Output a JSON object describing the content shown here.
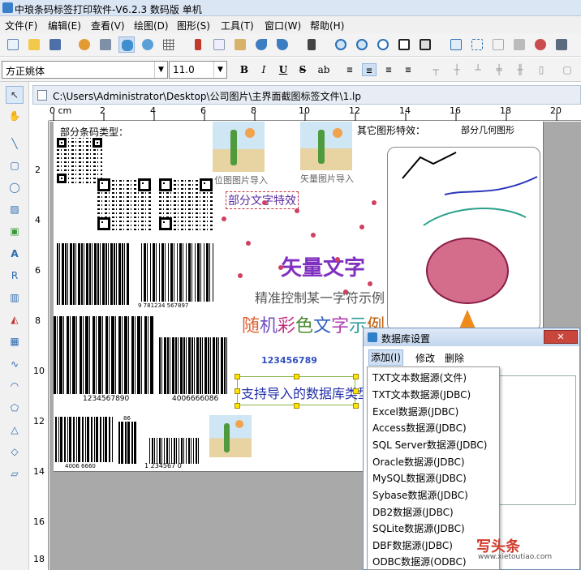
{
  "window": {
    "title": "中琅条码标签打印软件-V6.2.3 数码版 单机"
  },
  "menu": [
    "文件(F)",
    "编辑(E)",
    "查看(V)",
    "绘图(D)",
    "图形(S)",
    "工具(T)",
    "窗口(W)",
    "帮助(H)"
  ],
  "format_bar": {
    "font": "方正姚体",
    "size": "11.0",
    "bold": "B",
    "italic": "I",
    "underline": "U",
    "strike": "S"
  },
  "document": {
    "path": "C:\\Users\\Administrator\\Desktop\\公司图片\\主界面截图标签文件\\1.lp"
  },
  "ruler": {
    "top_ticks": [
      "0 cm",
      "2",
      "4",
      "6",
      "8",
      "10",
      "12",
      "14",
      "16",
      "18",
      "20"
    ],
    "left_ticks": [
      "2",
      "4",
      "6",
      "8",
      "10",
      "12",
      "14",
      "16",
      "18"
    ]
  },
  "canvas": {
    "label_barcode_types": "部分条码类型：",
    "barcode_text_1": "9   781234   567897",
    "barcode_text_2": "1234567890",
    "barcode_text_3": "4006666086",
    "barcode_text_4": "4006   6660",
    "barcode_text_5": "1   234567   0",
    "barcode_small": "86",
    "bitmap_import": "位图图片导入",
    "vector_import": "矢量图片导入",
    "text_effects": "部分文字特效",
    "vector_text": "矢量文字",
    "precise_control": "精准控制某一字符示例",
    "random_color": [
      "随",
      "机",
      "彩",
      "色",
      "文",
      "字",
      "示",
      "例"
    ],
    "random_color_colors": [
      "#e06030",
      "#7050c0",
      "#c03080",
      "#4a8a30",
      "#3060c0",
      "#b040b0",
      "#2a9a9a",
      "#c06010"
    ],
    "digits": "123456789",
    "db_types": "支持导入的数据库类型",
    "other_effects": "其它图形特效：",
    "geometry": "部分几何图形"
  },
  "dialog": {
    "title": "数据库设置",
    "close": "✕",
    "menu": {
      "add": "添加(I)",
      "edit": "修改",
      "delete": "删除"
    },
    "options": [
      "TXT文本数据源(文件)",
      "TXT文本数据源(JDBC)",
      "Excel数据源(JDBC)",
      "Access数据源(JDBC)",
      "SQL Server数据源(JDBC)",
      "Oracle数据源(JDBC)",
      "MySQL数据源(JDBC)",
      "Sybase数据源(JDBC)",
      "DB2数据源(JDBC)",
      "SQLite数据源(JDBC)",
      "DBF数据源(JDBC)",
      "ODBC数据源(ODBC)"
    ]
  },
  "watermark": {
    "text": "写头条",
    "url": "www.xietoutiao.com"
  },
  "icons": {
    "app": "barcode-app-icon",
    "tools": [
      "pointer-icon",
      "hand-icon",
      "line-icon",
      "rectangle-icon",
      "ellipse-icon",
      "image-icon",
      "picture-icon",
      "text-icon",
      "rich-text-icon",
      "barcode-icon",
      "shape-icon",
      "qr-icon",
      "curve-icon",
      "arc-icon",
      "polygon-icon",
      "triangle-icon",
      "diamond-icon",
      "parallelogram-icon"
    ]
  }
}
